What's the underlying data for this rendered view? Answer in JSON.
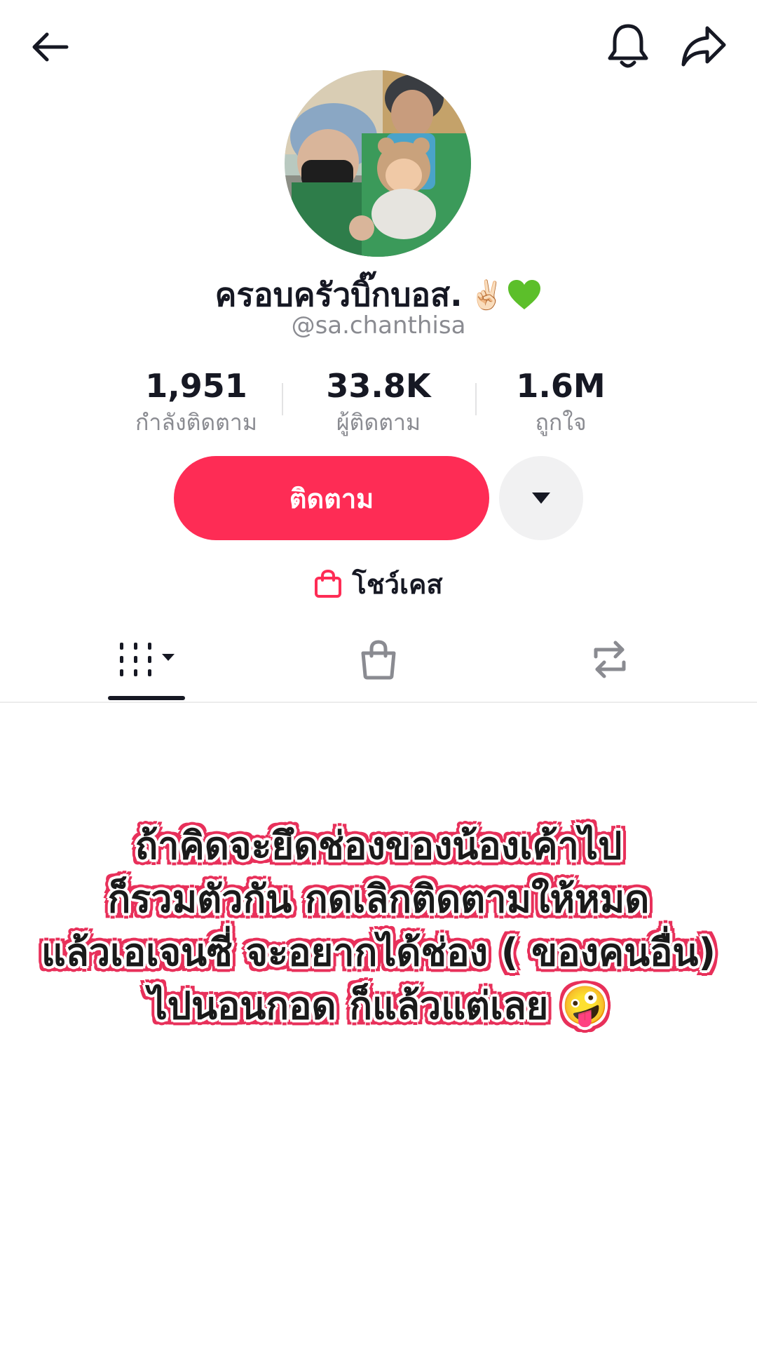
{
  "header": {
    "back_icon": "back-arrow-icon",
    "bell_icon": "bell-icon",
    "share_icon": "share-icon"
  },
  "profile": {
    "display_name": "ครอบครัวบิ๊กบอส.",
    "name_emojis": [
      "✌🏻",
      "💚"
    ],
    "username": "@sa.chanthisa"
  },
  "stats": [
    {
      "value": "1,951",
      "label": "กำลังติดตาม"
    },
    {
      "value": "33.8K",
      "label": "ผู้ติดตาม"
    },
    {
      "value": "1.6M",
      "label": "ถูกใจ"
    }
  ],
  "actions": {
    "follow_label": "ติดตาม",
    "more_icon": "caret-down-icon",
    "follow_color": "#fe2c55"
  },
  "showcase": {
    "icon": "shopping-bag-icon",
    "label": "โชว์เคส"
  },
  "tabs": [
    {
      "name": "videos",
      "icon": "grid-icon",
      "selected": true
    },
    {
      "name": "shop",
      "icon": "shopping-bag-icon",
      "selected": false
    },
    {
      "name": "reposts",
      "icon": "repost-icon",
      "selected": false
    }
  ],
  "overlay_caption": {
    "lines": [
      "ถ้าคิดจะยึดช่องของน้องเค้าไป",
      "ก็รวมตัวกัน กดเลิกติดตามให้หมด",
      "แล้วเอเจนซี่ จะอยากได้ช่อง ( ของคนอื่น)",
      "ไปนอนกอด ก็แล้วแต่เลย 🤪"
    ],
    "outline_color": "#e8305a"
  }
}
